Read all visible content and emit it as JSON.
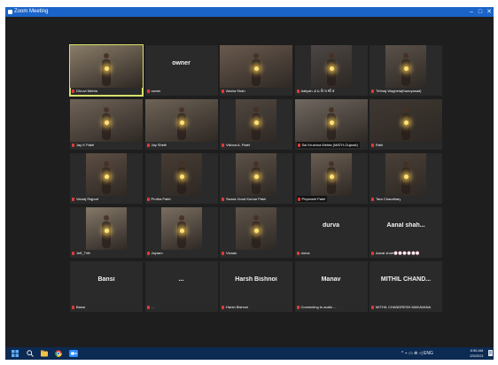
{
  "window": {
    "title": "Zoom Meeting",
    "controls": [
      "–",
      "□",
      "✕"
    ]
  },
  "participants": [
    {
      "kind": "video",
      "bg": "#8a7c68",
      "label": "Dhruvi Mehta",
      "boxed": false,
      "speaker": true,
      "narrow": false
    },
    {
      "kind": "name",
      "display": "owner",
      "label": "owner",
      "boxed": false
    },
    {
      "kind": "video",
      "bg": "#6a5a4e",
      "label": "Aksha Shah",
      "boxed": false,
      "narrow": false
    },
    {
      "kind": "video",
      "bg": "#4c4644",
      "label": "Aaliyah ડા ઇ તિ ધ ર્મા ક",
      "boxed": false,
      "narrow": true
    },
    {
      "kind": "video",
      "bg": "#5a524a",
      "label": "Tirthraj Waghela(Kaavyasad)",
      "boxed": false,
      "narrow": true
    },
    {
      "kind": "video",
      "bg": "#706458",
      "label": "Jay K Patel",
      "boxed": false,
      "narrow": false
    },
    {
      "kind": "video",
      "bg": "#6e6356",
      "label": "Jay Sheth",
      "boxed": false,
      "narrow": false
    },
    {
      "kind": "video",
      "bg": "#514740",
      "label": "Vishva A. Patel",
      "boxed": false,
      "narrow": true
    },
    {
      "kind": "video",
      "bg": "#706860",
      "label": "Sai Krushna Mehta (MATH-Gujarat)",
      "boxed": true,
      "narrow": false
    },
    {
      "kind": "video",
      "bg": "#3f3832",
      "label": "Rahi",
      "boxed": false,
      "narrow": false
    },
    {
      "kind": "video",
      "bg": "#5d4e44",
      "label": "Vanraj Rajpurt",
      "boxed": false,
      "narrow": true
    },
    {
      "kind": "video",
      "bg": "#463c34",
      "label": "Prutha Patel",
      "boxed": false,
      "narrow": true
    },
    {
      "kind": "video",
      "bg": "#5c5248",
      "label": "Swara Gond Kumar Patel",
      "boxed": false,
      "narrow": true
    },
    {
      "kind": "video",
      "bg": "#6a5e52",
      "label": "Priyanshi Patel",
      "boxed": true,
      "narrow": true
    },
    {
      "kind": "video",
      "bg": "#4a4038",
      "label": "Tara Chaudhary",
      "boxed": false,
      "narrow": true
    },
    {
      "kind": "video",
      "bg": "#847868",
      "label": "Jeff_Tirth",
      "boxed": false,
      "narrow": true
    },
    {
      "kind": "video",
      "bg": "#7a6e60",
      "label": "Jayram",
      "boxed": false,
      "narrow": true
    },
    {
      "kind": "video",
      "bg": "#5e544a",
      "label": "Vivaan",
      "boxed": false,
      "narrow": true
    },
    {
      "kind": "name",
      "display": "durva",
      "label": "durva",
      "boxed": false
    },
    {
      "kind": "name",
      "display": "Aanal shah...",
      "label": "Aanal shah💮💮💮💮💮💮",
      "boxed": false
    },
    {
      "kind": "name",
      "display": "Bansi",
      "label": "Bansi",
      "boxed": false
    },
    {
      "kind": "name",
      "display": "...",
      "label": "...",
      "boxed": false
    },
    {
      "kind": "name",
      "display": "Harsh Bishnoi",
      "label": "Harsh Bishnoi",
      "boxed": false
    },
    {
      "kind": "name",
      "display": "Manav",
      "label": "Connecting to audio ...",
      "boxed": false
    },
    {
      "kind": "name",
      "display": "MITHIL CHAND...",
      "label": "MITHIL CHANDRESH MAKAVANA",
      "boxed": false
    }
  ],
  "taskbar": {
    "icons": [
      "windows-start-icon",
      "search-icon",
      "file-explorer-icon",
      "chrome-icon",
      "zoom-app-icon"
    ],
    "tray_time": "8:56 AM",
    "tray_date": "2/5/2021",
    "tray_lang": "ENG",
    "tray_symbols": "^ ⌁ ▭ ⋒ ◁ ENG"
  },
  "colors": {
    "titlebar": "#1a64c8",
    "taskbar": "#0c2a52",
    "speaker_outline": "#d8e26a",
    "muted_mic": "#e23a3a"
  }
}
